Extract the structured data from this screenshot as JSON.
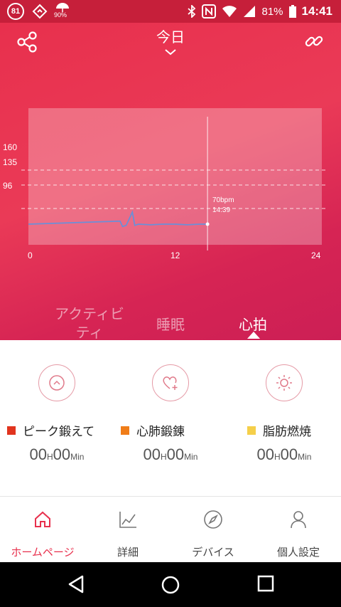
{
  "status_bar": {
    "circle_badge": "81",
    "umbrella_percent": "90%",
    "battery": "81%",
    "time": "14:41"
  },
  "header": {
    "title": "今日",
    "share_icon": "share-icon",
    "link_icon": "link-icon"
  },
  "chart_data": {
    "type": "line",
    "x_ticks": [
      "0",
      "12",
      "24"
    ],
    "y_ticks": [
      "160",
      "135",
      "96"
    ],
    "xlim": [
      0,
      24
    ],
    "series": [
      {
        "values": [
          [
            0,
            70
          ],
          [
            7.5,
            75
          ],
          [
            7.7,
            66
          ],
          [
            8,
            68
          ],
          [
            8.5,
            90
          ],
          [
            8.7,
            68
          ],
          [
            9,
            70
          ],
          [
            10,
            69
          ],
          [
            11,
            70
          ],
          [
            12,
            70
          ],
          [
            13,
            69
          ],
          [
            14,
            70
          ],
          [
            14.6,
            70
          ]
        ]
      }
    ],
    "annotation": {
      "value": "70bpm",
      "time": "14:39",
      "x": 14.65,
      "y": 70
    }
  },
  "tabs": [
    {
      "label": "アクティビ",
      "label2": "ティ"
    },
    {
      "label": "睡眠"
    },
    {
      "label": "心拍"
    }
  ],
  "zones": [
    {
      "icon": "chevron-up-circle-icon",
      "label": "ピーク鍛えて",
      "color": "#e1341e",
      "hours": "00",
      "h": "H",
      "mins": "00",
      "unit": "Min"
    },
    {
      "icon": "heart-plus-icon",
      "label": "心肺鍛錬",
      "color": "#f07d19",
      "hours": "00",
      "h": "H",
      "mins": "00",
      "unit": "Min"
    },
    {
      "icon": "sun-icon",
      "label": "脂肪燃焼",
      "color": "#f5cf4a",
      "hours": "00",
      "h": "H",
      "mins": "00",
      "unit": "Min"
    }
  ],
  "bottom_nav": [
    {
      "label": "ホームページ",
      "icon": "home-icon",
      "active": true
    },
    {
      "label": "詳細",
      "icon": "chart-icon"
    },
    {
      "label": "デバイス",
      "icon": "compass-icon"
    },
    {
      "label": "個人設定",
      "icon": "person-icon"
    }
  ]
}
